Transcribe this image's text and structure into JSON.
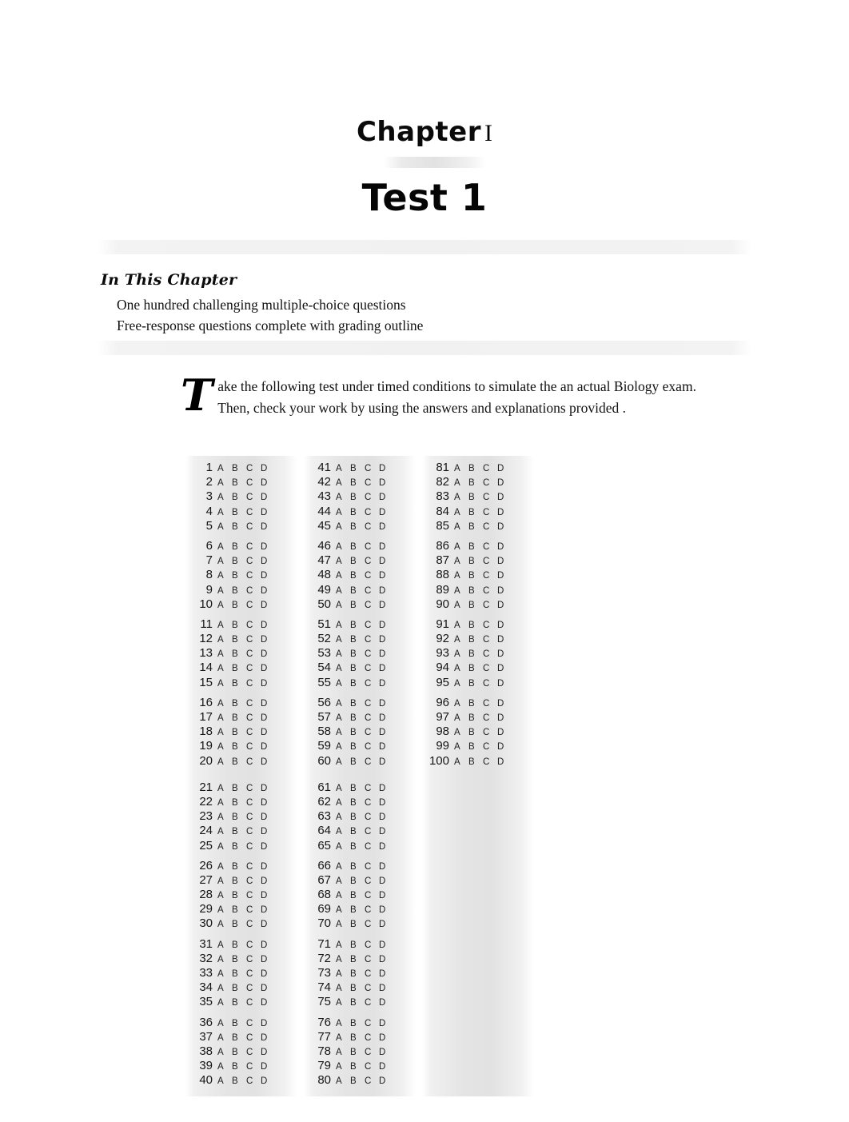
{
  "document": {
    "chapter_label": "Chapter",
    "chapter_numeral": "I",
    "test_title": "Test 1"
  },
  "in_this_chapter": {
    "heading": "In This Chapter",
    "items": [
      "One hundred challenging multiple-choice questions",
      "Free-response questions complete with grading outline"
    ]
  },
  "intro": {
    "dropcap": "T",
    "line1": "ake the following test under timed conditions to simulate the an actual  Biology exam.",
    "line2": "Then, check your work by using the answers and explanations provided ."
  },
  "answer_sheet": {
    "options": [
      "A",
      "B",
      "C",
      "D"
    ],
    "columns": [
      {
        "name": "column-1",
        "range_start": 1,
        "range_end": 40,
        "numbers": [
          1,
          2,
          3,
          4,
          5,
          6,
          7,
          8,
          9,
          10,
          11,
          12,
          13,
          14,
          15,
          16,
          17,
          18,
          19,
          20,
          21,
          22,
          23,
          24,
          25,
          26,
          27,
          28,
          29,
          30,
          31,
          32,
          33,
          34,
          35,
          36,
          37,
          38,
          39,
          40
        ]
      },
      {
        "name": "column-2",
        "range_start": 41,
        "range_end": 80,
        "numbers": [
          41,
          42,
          43,
          44,
          45,
          46,
          47,
          48,
          49,
          50,
          51,
          52,
          53,
          54,
          55,
          56,
          57,
          58,
          59,
          60,
          61,
          62,
          63,
          64,
          65,
          66,
          67,
          68,
          69,
          70,
          71,
          72,
          73,
          74,
          75,
          76,
          77,
          78,
          79,
          80
        ]
      },
      {
        "name": "column-3",
        "range_start": 81,
        "range_end": 100,
        "numbers": [
          81,
          82,
          83,
          84,
          85,
          86,
          87,
          88,
          89,
          90,
          91,
          92,
          93,
          94,
          95,
          96,
          97,
          98,
          99,
          100
        ]
      }
    ],
    "group_size": 5,
    "block_size": 20,
    "total_questions": 100
  },
  "colors": {
    "text": "#111111",
    "grid_shade": "#e4e4e4",
    "band_shade": "#f1f1f1",
    "page_background": "#ffffff"
  }
}
